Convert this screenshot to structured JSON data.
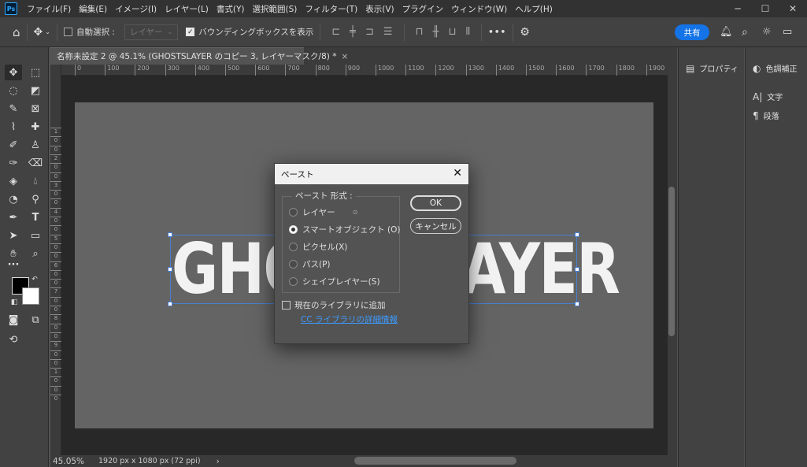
{
  "app": {
    "logo": "Ps"
  },
  "menu": [
    "ファイル(F)",
    "編集(E)",
    "イメージ(I)",
    "レイヤー(L)",
    "書式(Y)",
    "選択範囲(S)",
    "フィルター(T)",
    "表示(V)",
    "プラグイン",
    "ウィンドウ(W)",
    "ヘルプ(H)"
  ],
  "window_controls": {
    "minimize": "─",
    "maximize": "☐",
    "close": "✕"
  },
  "options": {
    "auto_select_label": "自動選択 :",
    "auto_select_target": "レイヤー",
    "bounding_box_label": "バウンディングボックスを表示",
    "more": "•••",
    "share": "共有"
  },
  "document": {
    "tab_title": "名称未設定 2 @ 45.1% (GHOSTSLAYER のコピー 3, レイヤーマスク/8) *",
    "close": "×",
    "canvas_text": "GHOSTSLAYER"
  },
  "ruler": {
    "h_ticks": [
      "0",
      "100",
      "200",
      "300",
      "400",
      "500",
      "600",
      "700",
      "800",
      "900",
      "1000",
      "1100",
      "1200",
      "1300",
      "1400",
      "1500",
      "1600",
      "1700",
      "1800",
      "1900"
    ],
    "v_ticks": [
      "1",
      "0",
      "0",
      "2",
      "0",
      "0",
      "3",
      "0",
      "0",
      "4",
      "0",
      "0",
      "5",
      "0",
      "0",
      "6",
      "0",
      "0",
      "7",
      "0",
      "0",
      "8",
      "0",
      "0",
      "9",
      "0",
      "0",
      "1",
      "0",
      "0",
      "0"
    ]
  },
  "status": {
    "zoom": "45.05%",
    "doc_info": "1920 px x 1080 px (72 ppi)",
    "arrow": "›"
  },
  "panels": {
    "mid": [
      {
        "icon": "properties-icon",
        "label": "プロパティ"
      }
    ],
    "right": [
      {
        "icon": "adjustments-icon",
        "label": "色調補正"
      },
      {
        "icon": "character-icon",
        "label": "文字"
      },
      {
        "icon": "paragraph-icon",
        "label": "段落"
      }
    ]
  },
  "dialog": {
    "title": "ペースト",
    "group_label": "ペースト 形式 :",
    "options": [
      "レイヤー",
      "スマートオブジェクト (O)",
      "ピクセル(X)",
      "パス(P)",
      "シェイプレイヤー(S)"
    ],
    "selected_index": 1,
    "ok": "OK",
    "cancel": "キャンセル",
    "add_to_library": "現在のライブラリに追加",
    "library_link": "CC ライブラリの詳細情報"
  }
}
